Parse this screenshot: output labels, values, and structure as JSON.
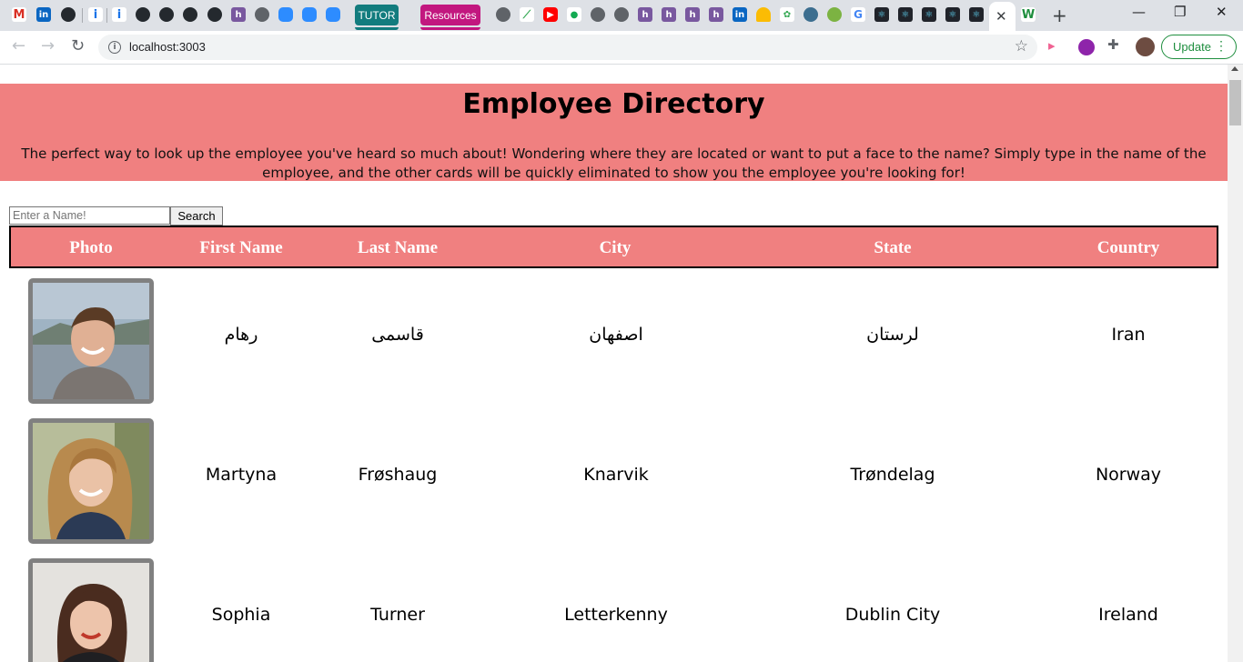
{
  "browser": {
    "tab_pills": [
      {
        "label": "TUTOR",
        "color": "#127c7e"
      },
      {
        "label": "Resources",
        "color": "#c2177f"
      }
    ],
    "url": "localhost:3003",
    "update_label": "Update"
  },
  "page": {
    "title": "Employee Directory",
    "description": "The perfect way to look up the employee you've heard so much about! Wondering where they are located or want to put a face to the name? Simply type in the name of the employee, and the other cards will be quickly eliminated to show you the employee you're looking for!",
    "search": {
      "placeholder": "Enter a Name!",
      "value": "",
      "button_label": "Search"
    },
    "accent_color": "#f08080",
    "table": {
      "headers": [
        "Photo",
        "First Name",
        "Last Name",
        "City",
        "State",
        "Country"
      ],
      "rows": [
        {
          "first": "رهام",
          "last": "قاسمی",
          "city": "اصفهان",
          "state": "لرستان",
          "country": "Iran"
        },
        {
          "first": "Martyna",
          "last": "Frøshaug",
          "city": "Knarvik",
          "state": "Trøndelag",
          "country": "Norway"
        },
        {
          "first": "Sophia",
          "last": "Turner",
          "city": "Letterkenny",
          "state": "Dublin City",
          "country": "Ireland"
        }
      ]
    }
  }
}
